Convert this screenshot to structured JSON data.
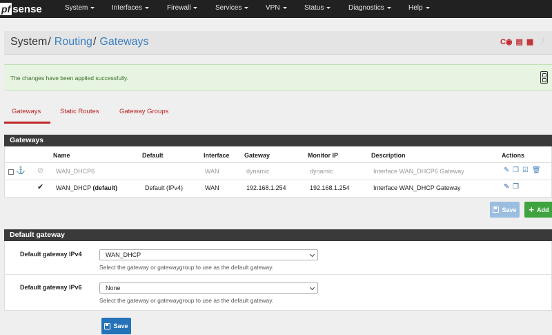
{
  "logo": {
    "pf": "pf",
    "sense": "sense"
  },
  "nav": [
    {
      "label": "System"
    },
    {
      "label": "Interfaces"
    },
    {
      "label": "Firewall"
    },
    {
      "label": "Services"
    },
    {
      "label": "VPN"
    },
    {
      "label": "Status"
    },
    {
      "label": "Diagnostics"
    },
    {
      "label": "Help"
    }
  ],
  "breadcrumb": {
    "root": "System",
    "section": "Routing",
    "page": "Gateways",
    "separator": "/"
  },
  "alert": {
    "text": "The changes have been applied successfully."
  },
  "tabs": [
    {
      "label": "Gateways",
      "active": true
    },
    {
      "label": "Static Routes",
      "active": false
    },
    {
      "label": "Gateway Groups",
      "active": false
    }
  ],
  "gateways_panel": {
    "title": "Gateways",
    "columns": [
      "Name",
      "Default",
      "Interface",
      "Gateway",
      "Monitor IP",
      "Description",
      "Actions"
    ],
    "rows": [
      {
        "name": "WAN_DHCP6",
        "name_suffix": "",
        "default": "",
        "interface": "WAN",
        "gateway": "dynamic",
        "monitor_ip": "dynamic",
        "description": "Interface WAN_DHCP6 Gateway",
        "disabled": true
      },
      {
        "name": "WAN_DHCP",
        "name_suffix": "(default)",
        "default": "Default (IPv4)",
        "interface": "WAN",
        "gateway": "192.168.1.254",
        "monitor_ip": "192.168.1.254",
        "description": "Interface WAN_DHCP Gateway",
        "disabled": false
      }
    ],
    "save_label": "Save",
    "add_label": "Add"
  },
  "default_gateway_panel": {
    "title": "Default gateway",
    "ipv4": {
      "label": "Default gateway IPv4",
      "value": "WAN_DHCP",
      "help": "Select the gateway or gatewaygroup to use as the default gateway."
    },
    "ipv6": {
      "label": "Default gateway IPv6",
      "value": "None",
      "help": "Select the gateway or gatewaygroup to use as the default gateway."
    },
    "save_label": "Save"
  },
  "colors": {
    "navbar": "#212121",
    "accent": "#c0262b",
    "link": "#3a7fbf",
    "success_bg": "#e6f4e1",
    "primary": "#2472b8",
    "add": "#3fa33f"
  }
}
